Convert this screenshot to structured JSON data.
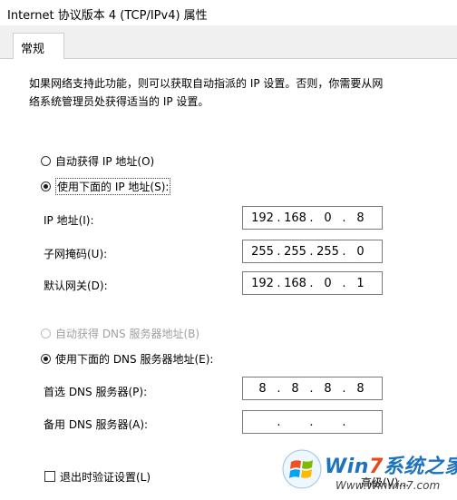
{
  "window": {
    "title": "Internet 协议版本 4 (TCP/IPv4) 属性"
  },
  "tabs": [
    {
      "label": "常规",
      "active": true
    }
  ],
  "description": {
    "line1": "如果网络支持此功能，则可以获取自动指派的 IP 设置。否则，你需要从网",
    "line2": "络系统管理员处获得适当的 IP 设置。"
  },
  "ip": {
    "auto_label": "自动获得 IP 地址(O)",
    "auto_checked": false,
    "manual_label": "使用下面的 IP 地址(S):",
    "manual_checked": true,
    "fields": {
      "address": {
        "label": "IP 地址(I):",
        "octets": [
          "192",
          "168",
          "0",
          "8"
        ]
      },
      "subnet": {
        "label": "子网掩码(U):",
        "octets": [
          "255",
          "255",
          "255",
          "0"
        ]
      },
      "gateway": {
        "label": "默认网关(D):",
        "octets": [
          "192",
          "168",
          "0",
          "1"
        ]
      }
    }
  },
  "dns": {
    "auto_label": "自动获得 DNS 服务器地址(B)",
    "auto_disabled": true,
    "manual_label": "使用下面的 DNS 服务器地址(E):",
    "manual_checked": true,
    "fields": {
      "preferred": {
        "label": "首选 DNS 服务器(P):",
        "octets": [
          "8",
          "8",
          "8",
          "8"
        ]
      },
      "alternate": {
        "label": "备用 DNS 服务器(A):",
        "octets": [
          "",
          "",
          "",
          ""
        ]
      }
    }
  },
  "validate": {
    "label": "退出时验证设置(L)",
    "checked": false
  },
  "advanced_partial": "高级(V)...",
  "watermark": {
    "brand_a": "Win",
    "brand_seven": "7",
    "brand_b": "系统之家",
    "url": "Www.Winwin7.com"
  },
  "colors": {
    "brand_blue": "#1e73be",
    "brand_orange": "#e64a19"
  }
}
